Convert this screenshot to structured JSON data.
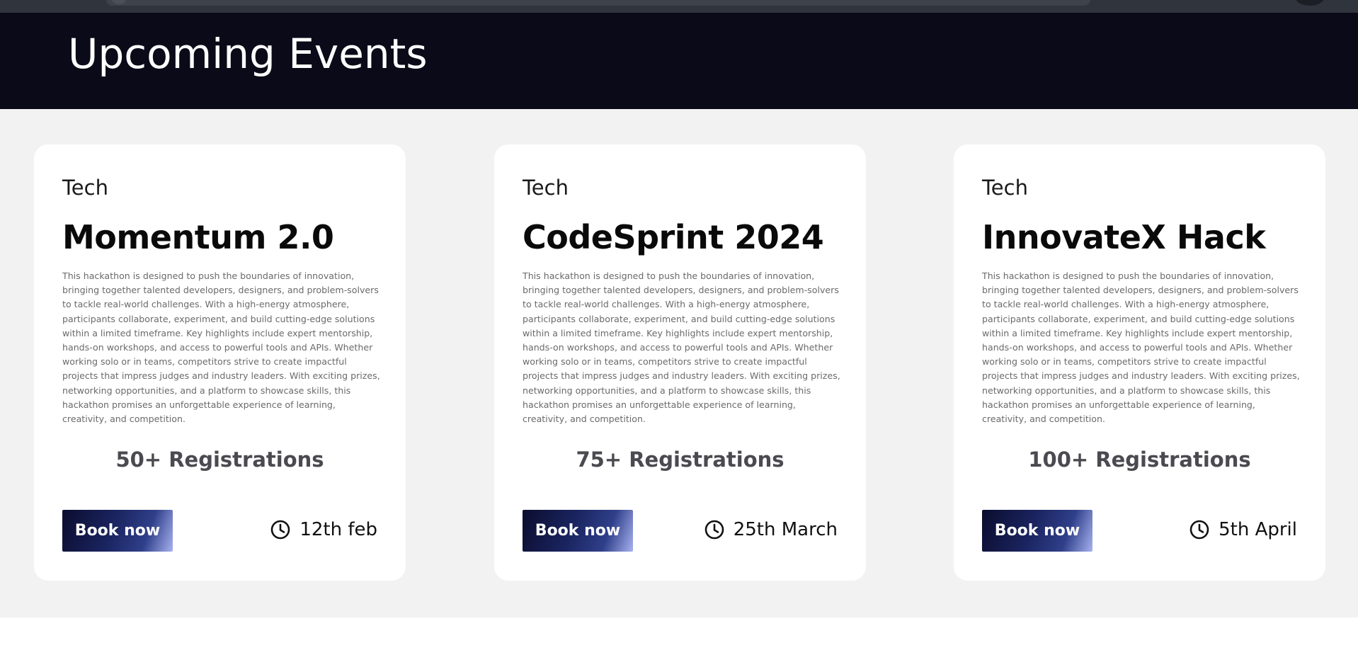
{
  "header": {
    "title": "Upcoming Events"
  },
  "events": [
    {
      "category": "Tech",
      "title": "Momentum 2.0",
      "description": "This hackathon is designed to push the boundaries of innovation, bringing together talented developers, designers, and problem-solvers to tackle real-world challenges. With a high-energy atmosphere, participants collaborate, experiment, and build cutting-edge solutions within a limited timeframe. Key highlights include expert mentorship, hands-on workshops, and access to powerful tools and APIs. Whether working solo or in teams, competitors strive to create impactful projects that impress judges and industry leaders. With exciting prizes, networking opportunities, and a platform to showcase skills, this hackathon promises an unforgettable experience of learning, creativity, and competition.",
      "registrations": "50+ Registrations",
      "book_label": "Book now",
      "date": "12th feb",
      "icon": "clock-icon"
    },
    {
      "category": "Tech",
      "title": "CodeSprint 2024",
      "description": "This hackathon is designed to push the boundaries of innovation, bringing together talented developers, designers, and problem-solvers to tackle real-world challenges. With a high-energy atmosphere, participants collaborate, experiment, and build cutting-edge solutions within a limited timeframe. Key highlights include expert mentorship, hands-on workshops, and access to powerful tools and APIs. Whether working solo or in teams, competitors strive to create impactful projects that impress judges and industry leaders. With exciting prizes, networking opportunities, and a platform to showcase skills, this hackathon promises an unforgettable experience of learning, creativity, and competition.",
      "registrations": "75+ Registrations",
      "book_label": "Book now",
      "date": "25th March",
      "icon": "clock-icon"
    },
    {
      "category": "Tech",
      "title": "InnovateX Hack",
      "description": "This hackathon is designed to push the boundaries of innovation, bringing together talented developers, designers, and problem-solvers to tackle real-world challenges. With a high-energy atmosphere, participants collaborate, experiment, and build cutting-edge solutions within a limited timeframe. Key highlights include expert mentorship, hands-on workshops, and access to powerful tools and APIs. Whether working solo or in teams, competitors strive to create impactful projects that impress judges and industry leaders. With exciting prizes, networking opportunities, and a platform to showcase skills, this hackathon promises an unforgettable experience of learning, creativity, and competition.",
      "registrations": "100+ Registrations",
      "book_label": "Book now",
      "date": "5th April",
      "icon": "clock-icon"
    }
  ],
  "colors": {
    "header_bg": "#0b0a18",
    "page_bg": "#f2f2f2",
    "card_bg": "#ffffff",
    "button_gradient_start": "#0b0d2e",
    "button_gradient_end": "#a7b2ef",
    "registrations_text": "#4a4a50"
  }
}
